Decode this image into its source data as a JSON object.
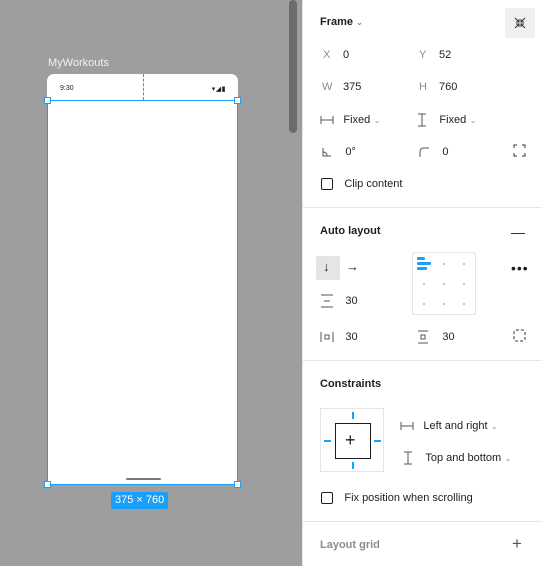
{
  "canvas": {
    "frame_name": "MyWorkouts",
    "status_time": "9:30",
    "status_icons": "▾◢▮",
    "size_badge": "375 × 760",
    "accent": "#18a0fb"
  },
  "frame": {
    "title": "Frame",
    "x_label": "X",
    "x_value": "0",
    "y_label": "Y",
    "y_value": "52",
    "w_label": "W",
    "w_value": "375",
    "h_label": "H",
    "h_value": "760",
    "width_mode": "Fixed",
    "height_mode": "Fixed",
    "rotation": "0°",
    "radius": "0",
    "clip_content": "Clip content"
  },
  "auto_layout": {
    "title": "Auto layout",
    "spacing": "30",
    "padding_h": "30",
    "padding_v": "30"
  },
  "constraints": {
    "title": "Constraints",
    "horizontal": "Left and right",
    "vertical": "Top and bottom",
    "fix_position": "Fix position when scrolling"
  },
  "layout_grid": {
    "title": "Layout grid"
  }
}
